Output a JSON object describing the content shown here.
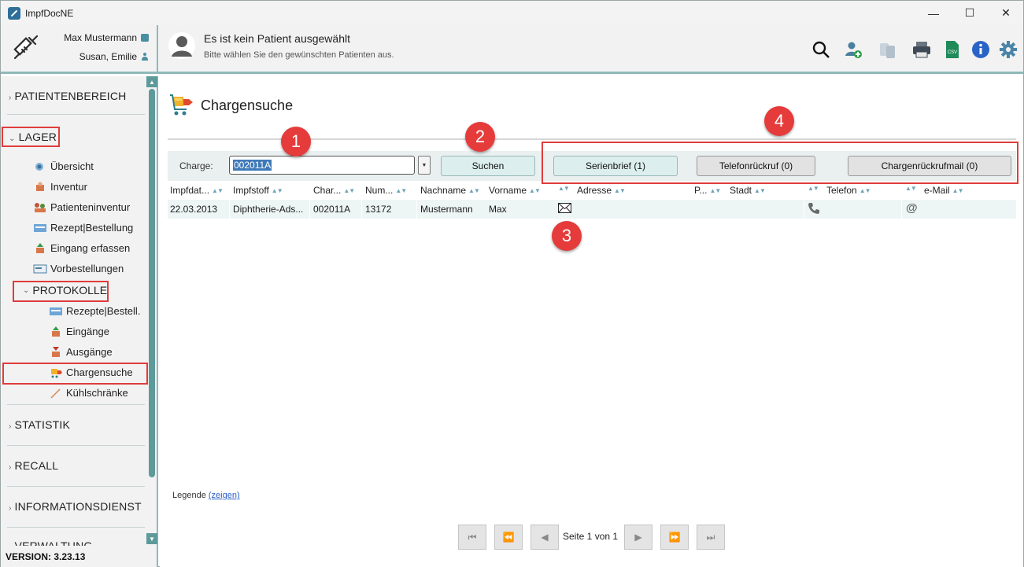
{
  "window": {
    "title": "ImpfDocNE",
    "minimize": "—",
    "maximize": "☐",
    "close": "✕"
  },
  "header": {
    "user_name": "Max Mustermann",
    "user_sub": "Susan, Emilie",
    "patient_title": "Es ist kein Patient ausgewählt",
    "patient_subtitle": "Bitte wählen Sie den gewünschten Patienten aus.",
    "toolbar_icons": [
      "search-icon",
      "add-patient-icon",
      "copy-icon",
      "print-icon",
      "csv-icon",
      "info-icon",
      "settings-icon"
    ],
    "csv_label": "CSV"
  },
  "sidebar": {
    "sections": [
      {
        "label": "PATIENTENBEREICH",
        "expanded": false
      },
      {
        "label": "LAGER",
        "expanded": true
      },
      {
        "label": "STATISTIK",
        "expanded": false
      },
      {
        "label": "RECALL",
        "expanded": false
      },
      {
        "label": "INFORMATIONSDIENST",
        "expanded": false
      },
      {
        "label": "VERWALTUNG",
        "expanded": false
      }
    ],
    "lager_items": [
      "Übersicht",
      "Inventur",
      "Patienteninventur",
      "Rezept|Bestellung",
      "Eingang erfassen",
      "Vorbestellungen"
    ],
    "protokolle_label": "PROTOKOLLE",
    "protokolle_items": [
      "Rezepte|Bestell.",
      "Eingänge",
      "Ausgänge",
      "Chargensuche",
      "Kühlschränke"
    ],
    "active_item": "Chargensuche",
    "version": "VERSION: 3.23.13"
  },
  "main": {
    "page_title": "Chargensuche",
    "charge_label": "Charge:",
    "charge_value": "002011A",
    "search_button": "Suchen",
    "serienbrief_button": "Serienbrief (1)",
    "telefon_button": "Telefonrückruf (0)",
    "mail_button": "Chargenrückrufmail (0)",
    "columns": [
      "Impfdat...",
      "Impfstoff",
      "Char...",
      "Num...",
      "Nachname",
      "Vorname",
      "",
      "Adresse",
      "P...",
      "Stadt",
      "",
      "Telefon",
      "",
      "e-Mail"
    ],
    "rows": [
      {
        "date": "22.03.2013",
        "vaccine": "Diphtherie-Ads...",
        "charge": "002011A",
        "number": "13172",
        "lastname": "Mustermann",
        "firstname": "Max",
        "letter_icon": "envelope-icon",
        "phone_icon": "phone-icon",
        "mail_icon": "at-icon"
      }
    ],
    "legend_label": "Legende",
    "legend_link": "(zeigen)",
    "pager_text": "Seite 1 von 1",
    "badges": [
      "1",
      "2",
      "3",
      "4"
    ]
  },
  "colors": {
    "accent": "#8fb9b9",
    "annotation_red": "#e53b3b",
    "selection_blue": "#3f7ab8"
  }
}
